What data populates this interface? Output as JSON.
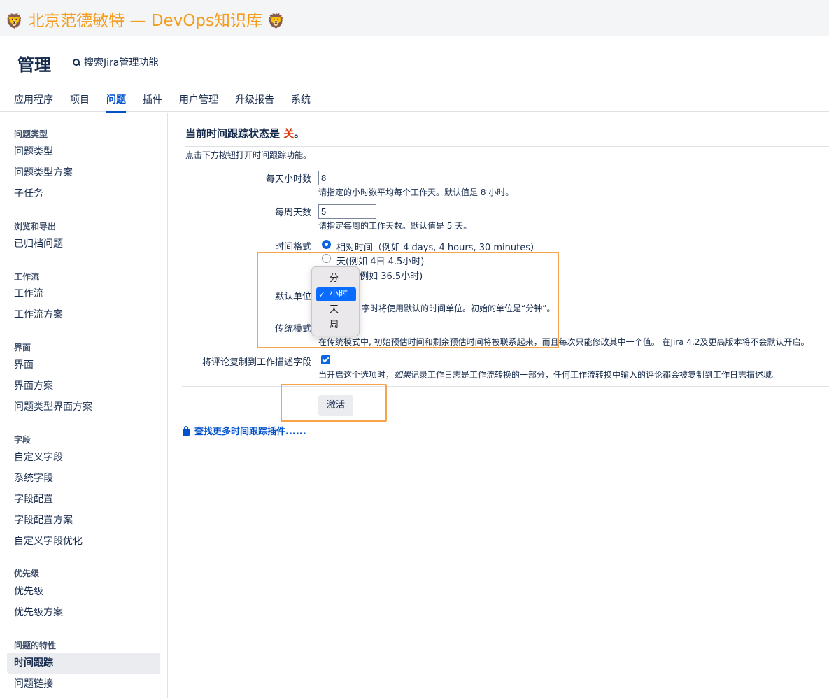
{
  "banner": {
    "title": "北京范德敏特 — DevOps知识库",
    "emoji": "🦁"
  },
  "header": {
    "title": "管理",
    "search_label": "搜索Jira管理功能",
    "tabs": [
      "应用程序",
      "项目",
      "问题",
      "插件",
      "用户管理",
      "升级报告",
      "系统"
    ],
    "active_tab": "问题"
  },
  "sidebar": {
    "groups": [
      {
        "title": "问题类型",
        "items": [
          "问题类型",
          "问题类型方案",
          "子任务"
        ]
      },
      {
        "title": "浏览和导出",
        "items": [
          "已归档问题"
        ]
      },
      {
        "title": "工作流",
        "items": [
          "工作流",
          "工作流方案"
        ]
      },
      {
        "title": "界面",
        "items": [
          "界面",
          "界面方案",
          "问题类型界面方案"
        ]
      },
      {
        "title": "字段",
        "items": [
          "自定义字段",
          "系统字段",
          "字段配置",
          "字段配置方案",
          "自定义字段优化"
        ]
      },
      {
        "title": "优先级",
        "items": [
          "优先级",
          "优先级方案"
        ]
      },
      {
        "title": "问题的特性",
        "items": [
          "时间跟踪",
          "问题链接"
        ]
      }
    ],
    "active_item": "时间跟踪"
  },
  "main": {
    "status_prefix": "当前时间跟踪状态是",
    "status_value": "关",
    "status_suffix": "。",
    "intro": "点击下方按钮打开时间跟踪功能。",
    "hours_per_day": {
      "label": "每天小时数",
      "value": "8",
      "desc": "请指定的小时数平均每个工作天。默认值是 8 小时。"
    },
    "days_per_week": {
      "label": "每周天数",
      "value": "5",
      "desc": "请指定每周的工作天数。默认值是 5 天。"
    },
    "time_format": {
      "label": "时间格式",
      "options": [
        "相对时间（例如 4 days, 4 hours, 30 minutes）",
        "天(例如 4日 4.5小时)",
        "(例如 36.5小时)"
      ],
      "selected_index": 0
    },
    "default_unit": {
      "label": "默认单位",
      "desc": "字时将使用默认的时间单位。初始的单位是“分钟”。"
    },
    "legacy_mode": {
      "label": "传统模式",
      "desc": "在传统模式中, 初始预估时间和剩余预估时间将被联系起来，而且每次只能修改其中一个值。 在Jira 4.2及更高版本将不会默认开启。"
    },
    "copy_comment": {
      "label": "将评论复制到工作描述字段",
      "checked": true,
      "desc_before": "当开启这个选项时，",
      "desc_em": "如果",
      "desc_after": "记录工作日志是工作流转换的一部分，任何工作流转换中输入的评论都会被复制到工作日志描述域。"
    },
    "activate_button": "激活",
    "more_link": "查找更多时间跟踪插件......"
  },
  "dropdown": {
    "options": [
      "分",
      "小时",
      "天",
      "周"
    ],
    "selected": "小时",
    "check_mark": "✓"
  },
  "colors": {
    "accent": "#0052cc",
    "banner_text": "#f39c1d",
    "status_off": "#de350b",
    "highlight": "#f7a34a",
    "dropdown_selected": "#0a6cff"
  }
}
